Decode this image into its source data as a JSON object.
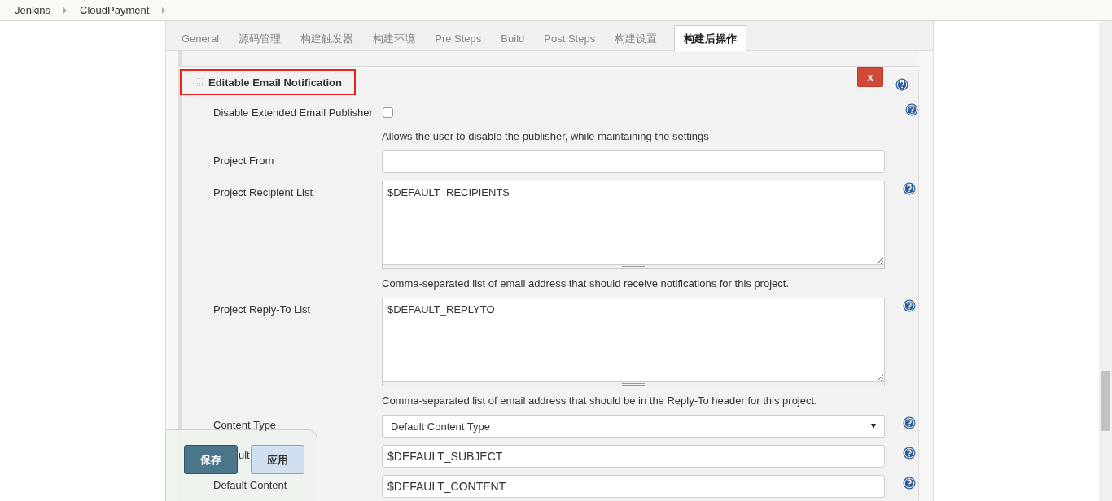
{
  "breadcrumbs": [
    {
      "label": "Jenkins"
    },
    {
      "label": "CloudPayment"
    }
  ],
  "tabs": [
    {
      "label": "General",
      "selected": false
    },
    {
      "label": "源码管理",
      "selected": false
    },
    {
      "label": "构建触发器",
      "selected": false
    },
    {
      "label": "构建环境",
      "selected": false
    },
    {
      "label": "Pre Steps",
      "selected": false
    },
    {
      "label": "Build",
      "selected": false
    },
    {
      "label": "Post Steps",
      "selected": false
    },
    {
      "label": "构建设置",
      "selected": false
    },
    {
      "label": "构建后操作",
      "selected": true
    }
  ],
  "section": {
    "title": "Editable Email Notification",
    "highlighted": true,
    "delete_button": "x",
    "help": true
  },
  "fields": [
    {
      "kind": "checkbox",
      "label": "Disable Extended Email Publisher",
      "checked": false,
      "help": true,
      "description": "Allows the user to disable the publisher, while maintaining the settings"
    },
    {
      "kind": "text",
      "label": "Project From",
      "help": false
    },
    {
      "kind": "textarea",
      "label": "Project Recipient List",
      "value": "$DEFAULT_RECIPIENTS",
      "help": true,
      "description": "Comma-separated list of email address that should receive notifications for this project."
    },
    {
      "kind": "textarea",
      "label": "Project Reply-To List",
      "value": "$DEFAULT_REPLYTO",
      "help": true,
      "description": "Comma-separated list of email address that should be in the Reply-To header for this project."
    },
    {
      "kind": "select",
      "label": "Content Type",
      "value": "Default Content Type",
      "help": true
    },
    {
      "kind": "text",
      "label": "ult",
      "covered": true,
      "value": "$DEFAULT_SUBJECT",
      "help": true
    },
    {
      "kind": "text",
      "label": "Default Content",
      "value": "$DEFAULT_CONTENT",
      "help": true
    }
  ],
  "save_bar": {
    "buttons": [
      {
        "label": "保存",
        "kind": "primary"
      },
      {
        "label": "应用",
        "kind": "secondary"
      }
    ]
  }
}
